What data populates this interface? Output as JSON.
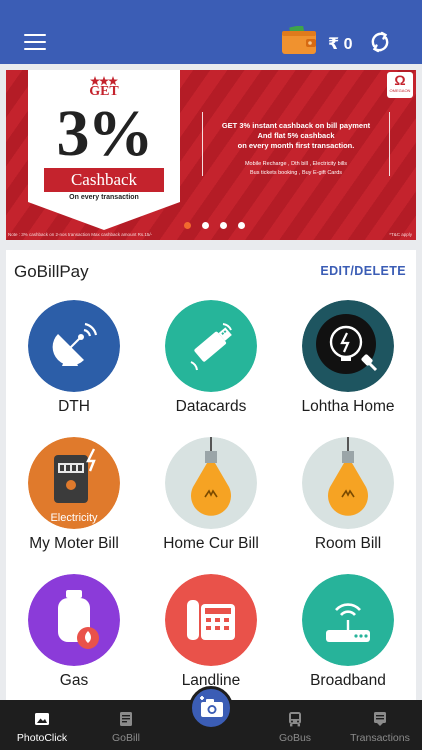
{
  "header": {
    "menu_icon": "hamburger-menu-icon",
    "wallet_icon": "wallet-icon",
    "balance": "₹ 0",
    "refresh_icon": "refresh-icon"
  },
  "banner": {
    "get": "GET",
    "percent": "3%",
    "cashback": "Cashback",
    "on_every": "On every transaction",
    "offer_line1": "GET 3% instant cashback on bill payment",
    "offer_line2": "And flat 5% cashback",
    "offer_line3": "on every month first transaction.",
    "services_line1": "Mobile Recharge , Dth bill , Electricity bills",
    "services_line2": "Bus tickets booking , Buy E-gift Cards",
    "brand": "OMEGAON",
    "note": "Note : 3% cashback on 2-nos transaction Max cashback amount Rs.15/-",
    "tc": "*T&C apply",
    "slide_count": 4,
    "active_slide": 0,
    "colors": {
      "red": "#c4232d",
      "dot_active": "#f26a2e"
    }
  },
  "gobillpay": {
    "title": "GoBillPay",
    "edit_label": "EDIT/DELETE",
    "tiles": [
      {
        "label": "DTH",
        "icon": "satellite-dish-icon",
        "bg": "#2c5ea8"
      },
      {
        "label": "Datacards",
        "icon": "usb-datacard-icon",
        "bg": "#26b59a"
      },
      {
        "label": "Lohtha Home",
        "icon": "bulb-plug-icon",
        "bg": "#1e5560"
      },
      {
        "label": "My Moter Bill",
        "icon": "electricity-meter-icon",
        "bg": "#e07a2c",
        "caption": "Electricity"
      },
      {
        "label": "Home Cur Bill",
        "icon": "light-bulb-icon",
        "bg": "#d8e2e1"
      },
      {
        "label": "Room Bill",
        "icon": "light-bulb-icon",
        "bg": "#d8e2e1"
      },
      {
        "label": "Gas",
        "icon": "gas-cylinder-icon",
        "bg": "#8b3bd9"
      },
      {
        "label": "Landline",
        "icon": "landline-phone-icon",
        "bg": "#e9524a"
      },
      {
        "label": "Broadband",
        "icon": "wifi-router-icon",
        "bg": "#27b39a"
      }
    ]
  },
  "bottom_nav": {
    "tabs": [
      {
        "label": "PhotoClick",
        "icon": "photo-icon",
        "active": true
      },
      {
        "label": "GoBill",
        "icon": "bill-icon",
        "active": false
      },
      {
        "label": "GoBus",
        "icon": "bus-icon",
        "active": false
      },
      {
        "label": "Transactions",
        "icon": "transactions-icon",
        "active": false
      }
    ],
    "camera_icon": "camera-add-icon",
    "accent": "#3b5db5"
  }
}
